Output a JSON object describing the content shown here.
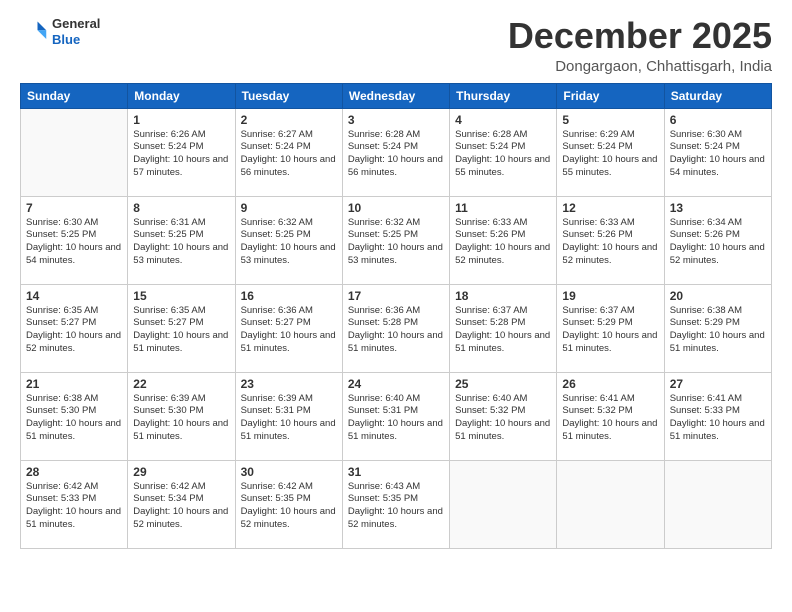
{
  "header": {
    "logo_line1": "General",
    "logo_line2": "Blue",
    "month": "December 2025",
    "location": "Dongargaon, Chhattisgarh, India"
  },
  "weekdays": [
    "Sunday",
    "Monday",
    "Tuesday",
    "Wednesday",
    "Thursday",
    "Friday",
    "Saturday"
  ],
  "weeks": [
    [
      {
        "day": "",
        "info": ""
      },
      {
        "day": "1",
        "info": "Sunrise: 6:26 AM\nSunset: 5:24 PM\nDaylight: 10 hours\nand 57 minutes."
      },
      {
        "day": "2",
        "info": "Sunrise: 6:27 AM\nSunset: 5:24 PM\nDaylight: 10 hours\nand 56 minutes."
      },
      {
        "day": "3",
        "info": "Sunrise: 6:28 AM\nSunset: 5:24 PM\nDaylight: 10 hours\nand 56 minutes."
      },
      {
        "day": "4",
        "info": "Sunrise: 6:28 AM\nSunset: 5:24 PM\nDaylight: 10 hours\nand 55 minutes."
      },
      {
        "day": "5",
        "info": "Sunrise: 6:29 AM\nSunset: 5:24 PM\nDaylight: 10 hours\nand 55 minutes."
      },
      {
        "day": "6",
        "info": "Sunrise: 6:30 AM\nSunset: 5:24 PM\nDaylight: 10 hours\nand 54 minutes."
      }
    ],
    [
      {
        "day": "7",
        "info": "Sunrise: 6:30 AM\nSunset: 5:25 PM\nDaylight: 10 hours\nand 54 minutes."
      },
      {
        "day": "8",
        "info": "Sunrise: 6:31 AM\nSunset: 5:25 PM\nDaylight: 10 hours\nand 53 minutes."
      },
      {
        "day": "9",
        "info": "Sunrise: 6:32 AM\nSunset: 5:25 PM\nDaylight: 10 hours\nand 53 minutes."
      },
      {
        "day": "10",
        "info": "Sunrise: 6:32 AM\nSunset: 5:25 PM\nDaylight: 10 hours\nand 53 minutes."
      },
      {
        "day": "11",
        "info": "Sunrise: 6:33 AM\nSunset: 5:26 PM\nDaylight: 10 hours\nand 52 minutes."
      },
      {
        "day": "12",
        "info": "Sunrise: 6:33 AM\nSunset: 5:26 PM\nDaylight: 10 hours\nand 52 minutes."
      },
      {
        "day": "13",
        "info": "Sunrise: 6:34 AM\nSunset: 5:26 PM\nDaylight: 10 hours\nand 52 minutes."
      }
    ],
    [
      {
        "day": "14",
        "info": "Sunrise: 6:35 AM\nSunset: 5:27 PM\nDaylight: 10 hours\nand 52 minutes."
      },
      {
        "day": "15",
        "info": "Sunrise: 6:35 AM\nSunset: 5:27 PM\nDaylight: 10 hours\nand 51 minutes."
      },
      {
        "day": "16",
        "info": "Sunrise: 6:36 AM\nSunset: 5:27 PM\nDaylight: 10 hours\nand 51 minutes."
      },
      {
        "day": "17",
        "info": "Sunrise: 6:36 AM\nSunset: 5:28 PM\nDaylight: 10 hours\nand 51 minutes."
      },
      {
        "day": "18",
        "info": "Sunrise: 6:37 AM\nSunset: 5:28 PM\nDaylight: 10 hours\nand 51 minutes."
      },
      {
        "day": "19",
        "info": "Sunrise: 6:37 AM\nSunset: 5:29 PM\nDaylight: 10 hours\nand 51 minutes."
      },
      {
        "day": "20",
        "info": "Sunrise: 6:38 AM\nSunset: 5:29 PM\nDaylight: 10 hours\nand 51 minutes."
      }
    ],
    [
      {
        "day": "21",
        "info": "Sunrise: 6:38 AM\nSunset: 5:30 PM\nDaylight: 10 hours\nand 51 minutes."
      },
      {
        "day": "22",
        "info": "Sunrise: 6:39 AM\nSunset: 5:30 PM\nDaylight: 10 hours\nand 51 minutes."
      },
      {
        "day": "23",
        "info": "Sunrise: 6:39 AM\nSunset: 5:31 PM\nDaylight: 10 hours\nand 51 minutes."
      },
      {
        "day": "24",
        "info": "Sunrise: 6:40 AM\nSunset: 5:31 PM\nDaylight: 10 hours\nand 51 minutes."
      },
      {
        "day": "25",
        "info": "Sunrise: 6:40 AM\nSunset: 5:32 PM\nDaylight: 10 hours\nand 51 minutes."
      },
      {
        "day": "26",
        "info": "Sunrise: 6:41 AM\nSunset: 5:32 PM\nDaylight: 10 hours\nand 51 minutes."
      },
      {
        "day": "27",
        "info": "Sunrise: 6:41 AM\nSunset: 5:33 PM\nDaylight: 10 hours\nand 51 minutes."
      }
    ],
    [
      {
        "day": "28",
        "info": "Sunrise: 6:42 AM\nSunset: 5:33 PM\nDaylight: 10 hours\nand 51 minutes."
      },
      {
        "day": "29",
        "info": "Sunrise: 6:42 AM\nSunset: 5:34 PM\nDaylight: 10 hours\nand 52 minutes."
      },
      {
        "day": "30",
        "info": "Sunrise: 6:42 AM\nSunset: 5:35 PM\nDaylight: 10 hours\nand 52 minutes."
      },
      {
        "day": "31",
        "info": "Sunrise: 6:43 AM\nSunset: 5:35 PM\nDaylight: 10 hours\nand 52 minutes."
      },
      {
        "day": "",
        "info": ""
      },
      {
        "day": "",
        "info": ""
      },
      {
        "day": "",
        "info": ""
      }
    ]
  ]
}
